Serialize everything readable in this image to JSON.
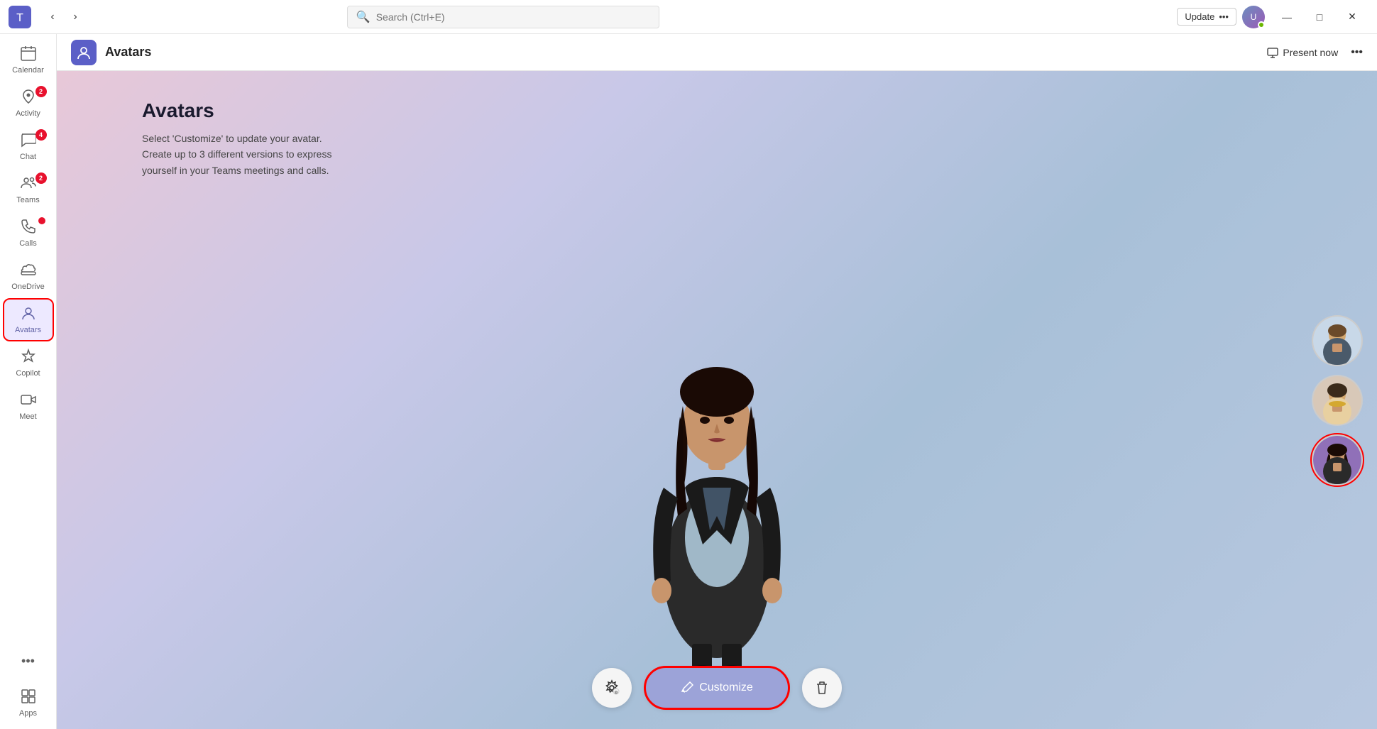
{
  "titlebar": {
    "search_placeholder": "Search (Ctrl+E)",
    "update_label": "Update",
    "update_more": "•••",
    "minimize": "—",
    "maximize": "□",
    "close": "✕"
  },
  "sidebar": {
    "items": [
      {
        "id": "calendar",
        "label": "Calendar",
        "icon": "📅",
        "badge": null,
        "active": false
      },
      {
        "id": "activity",
        "label": "Activity",
        "icon": "🔔",
        "badge": "2",
        "active": false
      },
      {
        "id": "chat",
        "label": "Chat",
        "icon": "💬",
        "badge": "4",
        "active": false
      },
      {
        "id": "teams",
        "label": "Teams",
        "icon": "👥",
        "badge": "2",
        "active": false
      },
      {
        "id": "calls",
        "label": "Calls",
        "icon": "📞",
        "badge_dot": true,
        "active": false
      },
      {
        "id": "onedrive",
        "label": "OneDrive",
        "icon": "☁",
        "badge": null,
        "active": false
      },
      {
        "id": "avatars",
        "label": "Avatars",
        "icon": "🧑",
        "badge": null,
        "active": true
      },
      {
        "id": "copilot",
        "label": "Copilot",
        "icon": "⟳",
        "badge": null,
        "active": false
      },
      {
        "id": "meet",
        "label": "Meet",
        "icon": "🎥",
        "badge": null,
        "active": false
      },
      {
        "id": "apps",
        "label": "Apps",
        "icon": "⊞",
        "badge": null,
        "active": false
      }
    ],
    "more_label": "•••"
  },
  "header": {
    "icon": "🧑",
    "title": "Avatars",
    "present_now": "Present now",
    "more": "•••"
  },
  "content": {
    "title": "Avatars",
    "description_line1": "Select 'Customize' to update your avatar.",
    "description_line2": "Create up to 3 different versions to express",
    "description_line3": "yourself in your Teams meetings and calls."
  },
  "controls": {
    "customize_label": "Customize",
    "settings_icon": "⚙",
    "delete_icon": "🗑",
    "pencil_icon": "✏"
  },
  "colors": {
    "accent": "#6264a7",
    "active_bg": "#ede9ff",
    "badge_red": "#e8112d",
    "customize_bg": "#9ca3d8",
    "title_bar_bg": "#ffffff",
    "sidebar_bg": "#ffffff"
  }
}
